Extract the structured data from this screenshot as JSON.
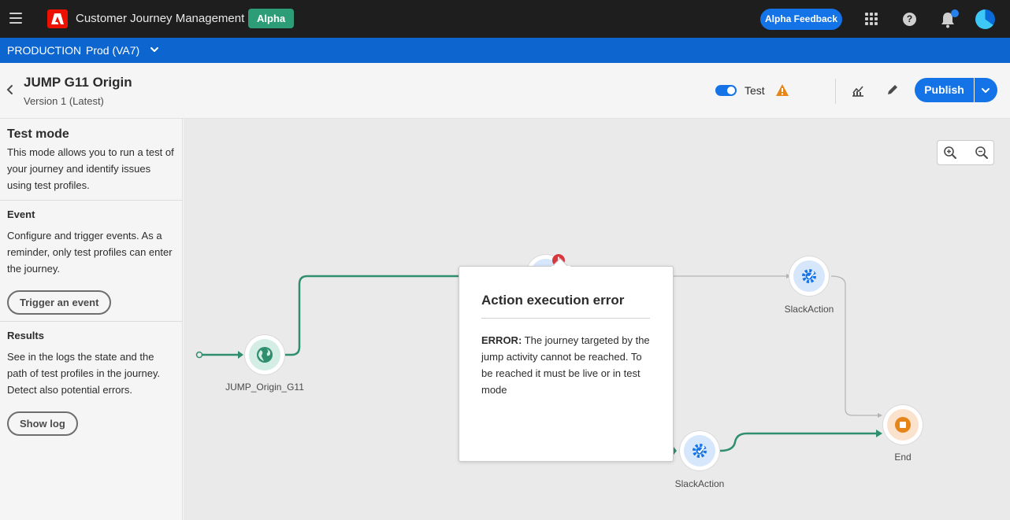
{
  "shell": {
    "app_title": "Customer Journey Management",
    "alpha_badge": "Alpha",
    "feedback_label": "Alpha Feedback",
    "help_glyph": "?"
  },
  "sandbox": {
    "environment": "PRODUCTION",
    "name": "Prod (VA7)"
  },
  "journey": {
    "name": "JUMP G11 Origin",
    "version": "Version 1 (Latest)",
    "test_label": "Test",
    "test_enabled": true,
    "publish_label": "Publish"
  },
  "left_panel": {
    "title": "Test mode",
    "intro": "This mode allows you to run a test of your journey and identify issues using test profiles.",
    "event_heading": "Event",
    "event_text": "Configure and trigger events. As a reminder, only test profiles can enter the journey.",
    "trigger_button": "Trigger an event",
    "results_heading": "Results",
    "results_text": "See in the logs the state and the path of test profiles in the journey. Detect also potential errors.",
    "show_log_button": "Show log"
  },
  "canvas": {
    "nodes": {
      "origin": "JUMP_Origin_G11",
      "slack_top": "SlackAction",
      "slack_bottom": "SlackAction",
      "end": "End"
    },
    "error_marker": "!"
  },
  "popup": {
    "title": "Action execution error",
    "error_prefix": "ERROR:",
    "error_text": " The journey targeted by the jump activity cannot be reached. To be reached it must be live or in test mode"
  },
  "colors": {
    "accent": "#1473e6",
    "path_success": "#2e8e6e",
    "error": "#d7373f",
    "warning": "#e68619",
    "end_node": "#e68619"
  }
}
